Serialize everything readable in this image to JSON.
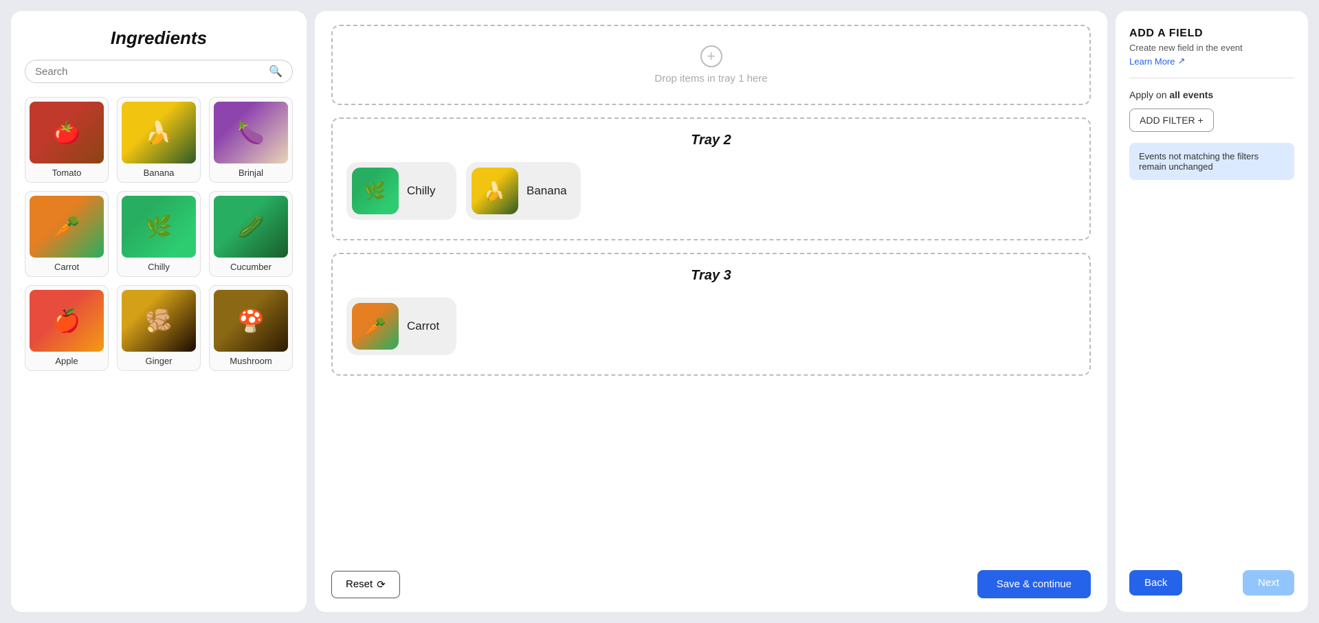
{
  "left_panel": {
    "title": "Ingredients",
    "search": {
      "placeholder": "Search",
      "value": ""
    },
    "ingredients": [
      {
        "id": "tomato",
        "name": "Tomato",
        "imgClass": "img-tomato",
        "emoji": "🍅"
      },
      {
        "id": "banana",
        "name": "Banana",
        "imgClass": "img-banana",
        "emoji": "🍌"
      },
      {
        "id": "brinjal",
        "name": "Brinjal",
        "imgClass": "img-brinjal",
        "emoji": "🍆"
      },
      {
        "id": "carrot",
        "name": "Carrot",
        "imgClass": "img-carrot",
        "emoji": "🥕"
      },
      {
        "id": "chilly",
        "name": "Chilly",
        "imgClass": "img-chilly",
        "emoji": "🌿"
      },
      {
        "id": "cucumber",
        "name": "Cucumber",
        "imgClass": "img-cucumber",
        "emoji": "🥒"
      },
      {
        "id": "apple",
        "name": "Apple",
        "imgClass": "img-apple",
        "emoji": "🍎"
      },
      {
        "id": "ginger",
        "name": "Ginger",
        "imgClass": "img-ginger",
        "emoji": "🫚"
      },
      {
        "id": "mushroom",
        "name": "Mushroom",
        "imgClass": "img-mushroom",
        "emoji": "🍄"
      }
    ]
  },
  "mid_panel": {
    "tray1": {
      "drop_text": "Drop items in tray 1 here"
    },
    "tray2": {
      "title": "Tray 2",
      "items": [
        {
          "name": "Chilly",
          "imgClass": "img-chilly",
          "emoji": "🌿"
        },
        {
          "name": "Banana",
          "imgClass": "img-banana",
          "emoji": "🍌"
        }
      ]
    },
    "tray3": {
      "title": "Tray 3",
      "items": [
        {
          "name": "Carrot",
          "imgClass": "img-carrot",
          "emoji": "🥕"
        }
      ]
    },
    "reset_label": "Reset",
    "save_label": "Save & continue"
  },
  "right_panel": {
    "add_field_title": "ADD A FIELD",
    "subtitle": "Create new field in the event",
    "learn_more": "Learn More",
    "apply_label_prefix": "Apply on ",
    "apply_label_bold": "all events",
    "add_filter_label": "ADD FILTER +",
    "info_text": "Events not matching the filters remain unchanged",
    "back_label": "Back",
    "next_label": "Next"
  }
}
